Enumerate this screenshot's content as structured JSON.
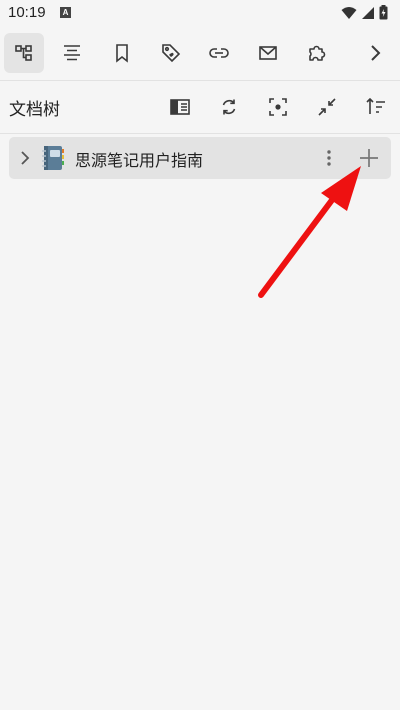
{
  "status_bar": {
    "time": "10:19",
    "notification_letter": "A"
  },
  "toolbar": {
    "items": [
      {
        "icon": "file-tree-icon",
        "active": true
      },
      {
        "icon": "outline-icon",
        "active": false
      },
      {
        "icon": "bookmark-icon",
        "active": false
      },
      {
        "icon": "tag-icon",
        "active": false
      },
      {
        "icon": "backlink-icon",
        "active": false
      },
      {
        "icon": "inbox-icon",
        "active": false
      },
      {
        "icon": "plugin-icon",
        "active": false
      },
      {
        "icon": "chevron-right-icon",
        "active": false
      }
    ]
  },
  "panel": {
    "title": "文档树",
    "actions": [
      "toggle-panel-icon",
      "refresh-icon",
      "focus-icon",
      "collapse-icon",
      "sort-icon"
    ]
  },
  "tree": {
    "items": [
      {
        "label": "思源笔记用户指南",
        "icon": "notebook-icon"
      }
    ]
  },
  "colors": {
    "background": "#f5f5f5",
    "active_tab": "#e4e4e4",
    "tree_item_bg": "#e3e3e3",
    "icon": "#3a3a3a",
    "annotation_arrow": "#ee1111"
  }
}
